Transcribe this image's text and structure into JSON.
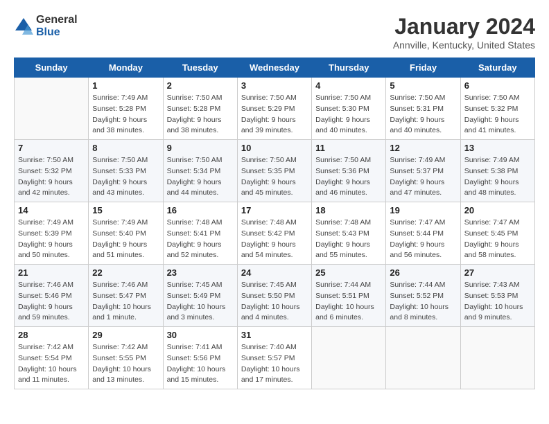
{
  "logo": {
    "text_general": "General",
    "text_blue": "Blue"
  },
  "title": "January 2024",
  "subtitle": "Annville, Kentucky, United States",
  "weekdays": [
    "Sunday",
    "Monday",
    "Tuesday",
    "Wednesday",
    "Thursday",
    "Friday",
    "Saturday"
  ],
  "weeks": [
    [
      {
        "day": "",
        "info": ""
      },
      {
        "day": "1",
        "info": "Sunrise: 7:49 AM\nSunset: 5:28 PM\nDaylight: 9 hours\nand 38 minutes."
      },
      {
        "day": "2",
        "info": "Sunrise: 7:50 AM\nSunset: 5:28 PM\nDaylight: 9 hours\nand 38 minutes."
      },
      {
        "day": "3",
        "info": "Sunrise: 7:50 AM\nSunset: 5:29 PM\nDaylight: 9 hours\nand 39 minutes."
      },
      {
        "day": "4",
        "info": "Sunrise: 7:50 AM\nSunset: 5:30 PM\nDaylight: 9 hours\nand 40 minutes."
      },
      {
        "day": "5",
        "info": "Sunrise: 7:50 AM\nSunset: 5:31 PM\nDaylight: 9 hours\nand 40 minutes."
      },
      {
        "day": "6",
        "info": "Sunrise: 7:50 AM\nSunset: 5:32 PM\nDaylight: 9 hours\nand 41 minutes."
      }
    ],
    [
      {
        "day": "7",
        "info": "Sunrise: 7:50 AM\nSunset: 5:32 PM\nDaylight: 9 hours\nand 42 minutes."
      },
      {
        "day": "8",
        "info": "Sunrise: 7:50 AM\nSunset: 5:33 PM\nDaylight: 9 hours\nand 43 minutes."
      },
      {
        "day": "9",
        "info": "Sunrise: 7:50 AM\nSunset: 5:34 PM\nDaylight: 9 hours\nand 44 minutes."
      },
      {
        "day": "10",
        "info": "Sunrise: 7:50 AM\nSunset: 5:35 PM\nDaylight: 9 hours\nand 45 minutes."
      },
      {
        "day": "11",
        "info": "Sunrise: 7:50 AM\nSunset: 5:36 PM\nDaylight: 9 hours\nand 46 minutes."
      },
      {
        "day": "12",
        "info": "Sunrise: 7:49 AM\nSunset: 5:37 PM\nDaylight: 9 hours\nand 47 minutes."
      },
      {
        "day": "13",
        "info": "Sunrise: 7:49 AM\nSunset: 5:38 PM\nDaylight: 9 hours\nand 48 minutes."
      }
    ],
    [
      {
        "day": "14",
        "info": "Sunrise: 7:49 AM\nSunset: 5:39 PM\nDaylight: 9 hours\nand 50 minutes."
      },
      {
        "day": "15",
        "info": "Sunrise: 7:49 AM\nSunset: 5:40 PM\nDaylight: 9 hours\nand 51 minutes."
      },
      {
        "day": "16",
        "info": "Sunrise: 7:48 AM\nSunset: 5:41 PM\nDaylight: 9 hours\nand 52 minutes."
      },
      {
        "day": "17",
        "info": "Sunrise: 7:48 AM\nSunset: 5:42 PM\nDaylight: 9 hours\nand 54 minutes."
      },
      {
        "day": "18",
        "info": "Sunrise: 7:48 AM\nSunset: 5:43 PM\nDaylight: 9 hours\nand 55 minutes."
      },
      {
        "day": "19",
        "info": "Sunrise: 7:47 AM\nSunset: 5:44 PM\nDaylight: 9 hours\nand 56 minutes."
      },
      {
        "day": "20",
        "info": "Sunrise: 7:47 AM\nSunset: 5:45 PM\nDaylight: 9 hours\nand 58 minutes."
      }
    ],
    [
      {
        "day": "21",
        "info": "Sunrise: 7:46 AM\nSunset: 5:46 PM\nDaylight: 9 hours\nand 59 minutes."
      },
      {
        "day": "22",
        "info": "Sunrise: 7:46 AM\nSunset: 5:47 PM\nDaylight: 10 hours\nand 1 minute."
      },
      {
        "day": "23",
        "info": "Sunrise: 7:45 AM\nSunset: 5:49 PM\nDaylight: 10 hours\nand 3 minutes."
      },
      {
        "day": "24",
        "info": "Sunrise: 7:45 AM\nSunset: 5:50 PM\nDaylight: 10 hours\nand 4 minutes."
      },
      {
        "day": "25",
        "info": "Sunrise: 7:44 AM\nSunset: 5:51 PM\nDaylight: 10 hours\nand 6 minutes."
      },
      {
        "day": "26",
        "info": "Sunrise: 7:44 AM\nSunset: 5:52 PM\nDaylight: 10 hours\nand 8 minutes."
      },
      {
        "day": "27",
        "info": "Sunrise: 7:43 AM\nSunset: 5:53 PM\nDaylight: 10 hours\nand 9 minutes."
      }
    ],
    [
      {
        "day": "28",
        "info": "Sunrise: 7:42 AM\nSunset: 5:54 PM\nDaylight: 10 hours\nand 11 minutes."
      },
      {
        "day": "29",
        "info": "Sunrise: 7:42 AM\nSunset: 5:55 PM\nDaylight: 10 hours\nand 13 minutes."
      },
      {
        "day": "30",
        "info": "Sunrise: 7:41 AM\nSunset: 5:56 PM\nDaylight: 10 hours\nand 15 minutes."
      },
      {
        "day": "31",
        "info": "Sunrise: 7:40 AM\nSunset: 5:57 PM\nDaylight: 10 hours\nand 17 minutes."
      },
      {
        "day": "",
        "info": ""
      },
      {
        "day": "",
        "info": ""
      },
      {
        "day": "",
        "info": ""
      }
    ]
  ]
}
